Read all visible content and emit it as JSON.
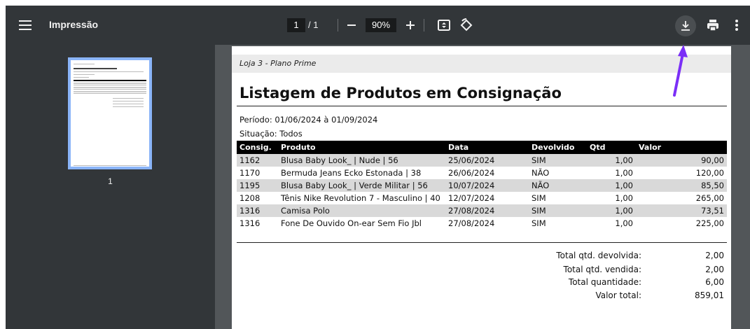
{
  "toolbar": {
    "title": "Impressão",
    "page_current": "1",
    "page_total": "/ 1",
    "zoom": "90%",
    "icons": [
      "menu-icon",
      "zoom-out-icon",
      "zoom-in-icon",
      "fit-page-icon",
      "rotate-icon",
      "download-icon",
      "print-icon",
      "more-vert-icon"
    ]
  },
  "sidebar": {
    "thumbnail_page": "1"
  },
  "document": {
    "store": "Loja 3 - Plano Prime",
    "title": "Listagem de Produtos em Consignação",
    "period": "Período: 01/06/2024 à 01/09/2024",
    "situation": "Situação: Todos",
    "columns": [
      "Consig.",
      "Produto",
      "Data",
      "Devolvido",
      "Qtd",
      "Valor"
    ],
    "rows": [
      [
        "1162",
        "Blusa Baby Look_ | Nude | 56",
        "25/06/2024",
        "SIM",
        "1,00",
        "90,00"
      ],
      [
        "1170",
        "Bermuda Jeans Ecko Estonada | 38",
        "26/06/2024",
        "NÃO",
        "1,00",
        "120,00"
      ],
      [
        "1195",
        "Blusa Baby Look_ | Verde Militar | 56",
        "10/07/2024",
        "NÃO",
        "1,00",
        "85,50"
      ],
      [
        "1208",
        "Tênis Nike Revolution 7 - Masculino | 40",
        "12/07/2024",
        "SIM",
        "1,00",
        "265,00"
      ],
      [
        "1316",
        "Camisa Polo",
        "27/08/2024",
        "SIM",
        "1,00",
        "73,51"
      ],
      [
        "1316",
        "Fone De Ouvido On-ear Sem Fio Jbl",
        "27/08/2024",
        "SIM",
        "1,00",
        "225,00"
      ]
    ],
    "totals": [
      {
        "label": "Total qtd. devolvida:",
        "value": "2,00"
      },
      {
        "label": "Total qtd. vendida:",
        "value": "2,00"
      },
      {
        "label": "Total quantidade:",
        "value": "6,00"
      },
      {
        "label": "Valor total:",
        "value": "859,01"
      }
    ]
  },
  "annotation": {
    "color": "#7b2ff7",
    "target": "download-icon"
  },
  "colors": {
    "toolbar": "#323639",
    "viewer_bg": "#525659",
    "thumb_border": "#8ab4f8",
    "header_row": "#000000",
    "shade_row": "#d9d9d9"
  }
}
